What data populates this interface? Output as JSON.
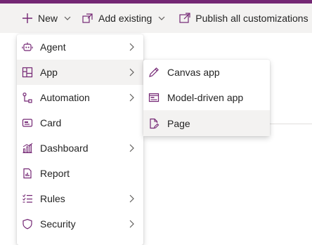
{
  "colors": {
    "brand": "#742774",
    "commandbar": "#f3f2f1",
    "hover": "#f3f2f1",
    "icon": "#742774",
    "text": "#242424"
  },
  "commandbar": {
    "new_label": "New",
    "add_existing_label": "Add existing",
    "publish_label": "Publish all customizations"
  },
  "new_menu": {
    "items": [
      {
        "label": "Agent",
        "icon": "bot-icon",
        "submenu": true
      },
      {
        "label": "App",
        "icon": "app-icon",
        "submenu": true,
        "selected": true
      },
      {
        "label": "Automation",
        "icon": "flow-icon",
        "submenu": true
      },
      {
        "label": "Card",
        "icon": "card-icon",
        "submenu": false
      },
      {
        "label": "Dashboard",
        "icon": "dashboard-icon",
        "submenu": true
      },
      {
        "label": "Report",
        "icon": "report-icon",
        "submenu": false
      },
      {
        "label": "Rules",
        "icon": "rules-icon",
        "submenu": true
      },
      {
        "label": "Security",
        "icon": "shield-icon",
        "submenu": true
      }
    ]
  },
  "app_submenu": {
    "items": [
      {
        "label": "Canvas app",
        "icon": "pen-icon"
      },
      {
        "label": "Model-driven app",
        "icon": "form-icon"
      },
      {
        "label": "Page",
        "icon": "page-edit-icon",
        "highlighted": true
      }
    ]
  }
}
